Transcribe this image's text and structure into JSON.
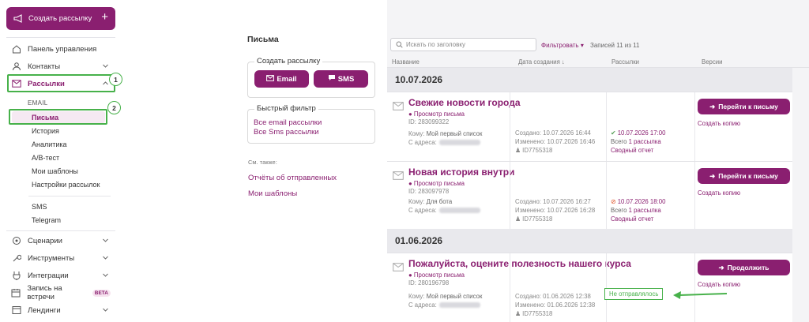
{
  "sidebar": {
    "create_label": "Создать рассылку",
    "nav": [
      {
        "label": "Панель управления",
        "icon": "home-icon"
      },
      {
        "label": "Контакты",
        "icon": "contacts-icon"
      },
      {
        "label": "Рассылки",
        "icon": "mail-icon"
      }
    ],
    "email_label": "EMAIL",
    "sub": [
      "Письма",
      "История",
      "Аналитика",
      "A/B-тест",
      "Мои шаблоны",
      "Настройки рассылок",
      "SMS",
      "Telegram"
    ],
    "nav2": [
      {
        "label": "Сценарии"
      },
      {
        "label": "Инструменты"
      },
      {
        "label": "Интеграции"
      },
      {
        "label": "Запись на встречи",
        "badge": "BETA"
      },
      {
        "label": "Лендинги"
      }
    ],
    "callouts": [
      "1",
      "2"
    ]
  },
  "middle": {
    "title": "Письма",
    "create_legend": "Создать рассылку",
    "email_btn": "Email",
    "sms_btn": "SMS",
    "filter_legend": "Быстрый фильтр",
    "filter_links": [
      "Все email рассылки",
      "Все Sms рассылки"
    ],
    "see_also": "См. также:",
    "links": [
      "Отчёты об отправленных",
      "Мои шаблоны"
    ]
  },
  "list": {
    "search_placeholder": "Искать по заголовку",
    "filter": "Фильтровать",
    "records": "Записей 11 из 11",
    "columns": [
      "Название",
      "Дата создания ↓",
      "Рассылки",
      "Версии"
    ],
    "sections": [
      {
        "date": "10.07.2026",
        "rows": [
          {
            "title": "Свежие новости города",
            "preview": "Просмотр письма",
            "id": "ID: 283099322",
            "to_label": "Кому:",
            "to_value": "Мой первый список",
            "from_label": "С адреса:",
            "created": "Создано: 10.07.2026 16:44",
            "changed": "Изменено: 10.07.2026 16:46",
            "user": "ID7755318",
            "status": "10.07.2026 17:00",
            "total_label": "Всего",
            "total_link": "1 рассылка",
            "report": "Сводный отчет",
            "action": "Перейти к письму",
            "copy": "Создать копию"
          },
          {
            "title": "Новая история внутри",
            "preview": "Просмотр письма",
            "id": "ID: 283097978",
            "to_label": "Кому:",
            "to_value": "Для бота",
            "from_label": "С адреса:",
            "created": "Создано: 10.07.2026 16:27",
            "changed": "Изменено: 10.07.2026 16:28",
            "user": "ID7755318",
            "status": "10.07.2026 18:00",
            "total_label": "Всего",
            "total_link": "1 рассылка",
            "report": "Сводный отчет",
            "action": "Перейти к письму",
            "copy": "Создать копию"
          }
        ]
      },
      {
        "date": "01.06.2026",
        "rows": [
          {
            "title": "Пожалуйста, оцените полезность нашего курса",
            "preview": "Просмотр письма",
            "id": "ID: 280196798",
            "to_label": "Кому:",
            "to_value": "Мой первый список",
            "from_label": "С адреса:",
            "created": "Создано: 01.06.2026 12:38",
            "changed": "Изменено: 01.06.2026 12:38",
            "user": "ID7755318",
            "not_sent": "Не отправлялось",
            "action": "Продолжить",
            "copy": "Создать копию"
          }
        ]
      }
    ]
  },
  "colors": {
    "brand": "#8a1f70",
    "annotation": "#47b14a",
    "panel": "#f4f4f6"
  }
}
